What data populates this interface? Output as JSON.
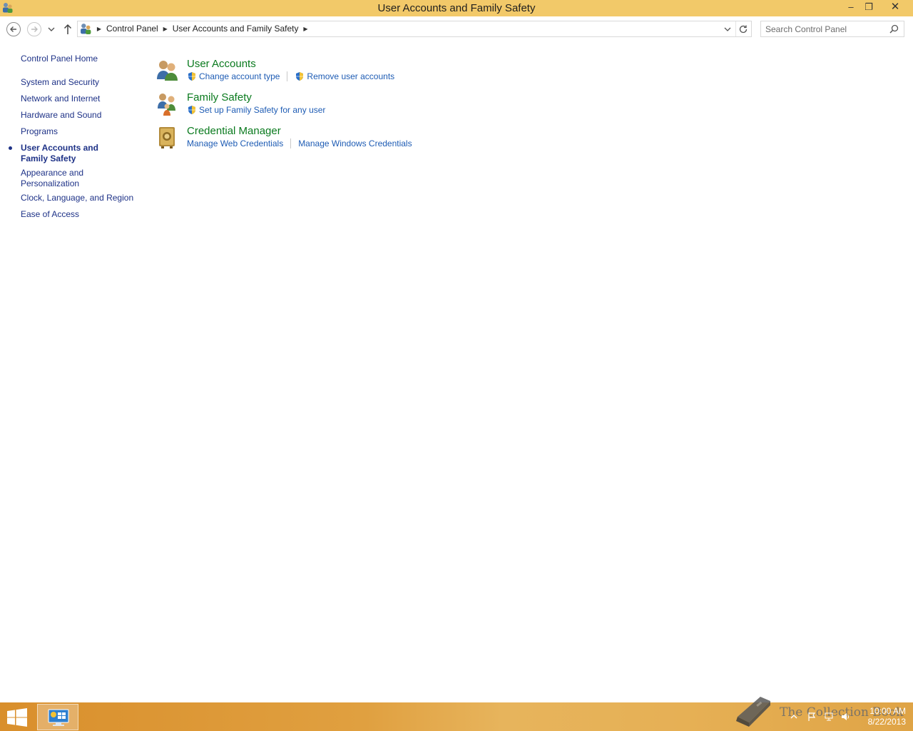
{
  "window": {
    "title": "User Accounts and Family Safety",
    "minimize": "–",
    "restore": "❐",
    "close": "✕"
  },
  "navigation": {
    "breadcrumbs": [
      "Control Panel",
      "User Accounts and Family Safety"
    ],
    "search_placeholder": "Search Control Panel"
  },
  "sidebar": {
    "home": "Control Panel Home",
    "items": [
      {
        "label": "System and Security"
      },
      {
        "label": "Network and Internet"
      },
      {
        "label": "Hardware and Sound"
      },
      {
        "label": "Programs"
      },
      {
        "label": "User Accounts and Family Safety",
        "active": true
      },
      {
        "label": "Appearance and Personalization"
      },
      {
        "label": "Clock, Language, and Region"
      },
      {
        "label": "Ease of Access"
      }
    ]
  },
  "categories": [
    {
      "title": "User Accounts",
      "icon": "users-icon",
      "links": [
        {
          "label": "Change account type",
          "shield": true
        },
        {
          "label": "Remove user accounts",
          "shield": true
        }
      ]
    },
    {
      "title": "Family Safety",
      "icon": "family-icon",
      "links": [
        {
          "label": "Set up Family Safety for any user",
          "shield": true
        }
      ]
    },
    {
      "title": "Credential Manager",
      "icon": "vault-icon",
      "links": [
        {
          "label": "Manage Web Credentials",
          "shield": false
        },
        {
          "label": "Manage Windows Credentials",
          "shield": false
        }
      ]
    }
  ],
  "taskbar": {
    "time": "10:00 AM",
    "date": "8/22/2013",
    "watermark": "The Collection Book"
  },
  "colors": {
    "titlebar": "#f2c969",
    "link": "#1e5cb4",
    "category_title": "#0a7a1e",
    "nav_text": "#1e3287"
  }
}
